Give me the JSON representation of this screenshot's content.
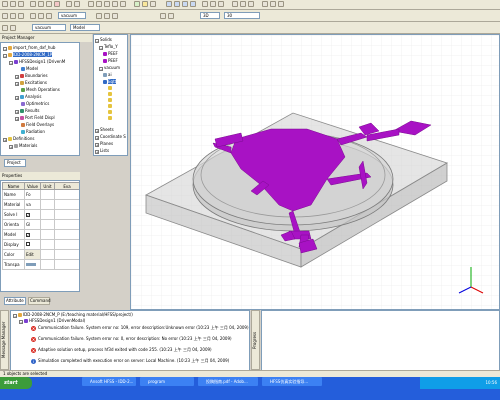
{
  "toolbar": {
    "material_select": "vacuum",
    "model_select": "Model",
    "view_select": "3D",
    "zoom_value": "30"
  },
  "project_manager": {
    "title": "Project Manager",
    "items": [
      {
        "label": "import_from_dxf_hub"
      },
      {
        "label": "IDD-2008-2NCM_1P"
      },
      {
        "label": "HFSSDesign1 (DrivenM"
      },
      {
        "label": "Model"
      },
      {
        "label": "Boundaries"
      },
      {
        "label": "Excitations"
      },
      {
        "label": "Mesh Operations"
      },
      {
        "label": "Analysis"
      },
      {
        "label": "Optimetrics"
      },
      {
        "label": "Results"
      },
      {
        "label": "Port Field Displ"
      },
      {
        "label": "Field Overlays"
      },
      {
        "label": "Radiation"
      },
      {
        "label": "Definitions"
      },
      {
        "label": "Materials"
      }
    ],
    "tab": "Project"
  },
  "model_tree": {
    "items": [
      {
        "label": "Solids"
      },
      {
        "label": "Teflo_Y"
      },
      {
        "label": "PEEF"
      },
      {
        "label": "PEEF"
      },
      {
        "label": "vacuum"
      },
      {
        "label": "ai"
      },
      {
        "label": "Eqtt"
      },
      {
        "label": "Sheets"
      },
      {
        "label": "Coordinate S"
      },
      {
        "label": "Planes"
      },
      {
        "label": "Lists"
      }
    ]
  },
  "properties": {
    "title": "Properties",
    "headers": [
      "Name",
      "Value",
      "Unit",
      "Eva"
    ],
    "rows": [
      {
        "name": "Name",
        "value": "Fo"
      },
      {
        "name": "Material",
        "value": "va"
      },
      {
        "name": "Solve I",
        "value": ""
      },
      {
        "name": "Orienta",
        "value": "Gl"
      },
      {
        "name": "Model",
        "value": ""
      },
      {
        "name": "Display",
        "value": ""
      },
      {
        "name": "Color",
        "value": "Edit"
      },
      {
        "name": "Transpa",
        "value": ""
      }
    ],
    "tabs": [
      "Attribute",
      "Command"
    ]
  },
  "messages": {
    "tab_left": "Message Manager",
    "tab_right": "Progress",
    "project_line": "IDD-2008-2NCM_P (E:/teaching material/HFSS/project/)",
    "design_line": "HFSSDesign1 (DrivenModal)",
    "entries": [
      {
        "type": "error",
        "text": "Communication failure. System error no: 109, error description:Unknown error (10:23 上午  三月 04, 2009)"
      },
      {
        "type": "error",
        "text": "Communication failure. System error no: 0, error description: No error (10:23 上午  三月 04, 2009)"
      },
      {
        "type": "error",
        "text": "Adaptive solution setup, process hf3d exited with code 255. (10:23 上午  三月 04, 2009)"
      },
      {
        "type": "info",
        "text": "Simulation completed with execution error on server: Local Machine. (10:23 上午  三月 04, 2009)"
      }
    ]
  },
  "status_bar": {
    "text": "1 objects are selected"
  },
  "taskbar": {
    "start_label": "start",
    "items": [
      "Ansoft HFSS - IDD-2...",
      "program",
      "投稿指南.pdf - Adob...",
      "HFSS仿真实验指导..."
    ],
    "tray_time": "10:56"
  },
  "colors": {
    "accent_magenta": "#a812c4",
    "taskbar_blue": "#245edb",
    "start_green": "#3c9c3a"
  }
}
